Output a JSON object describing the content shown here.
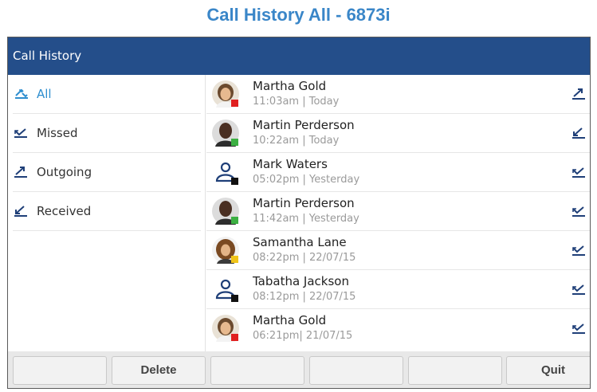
{
  "page": {
    "title": "Call History All - 6873i"
  },
  "screen": {
    "header": "Call History",
    "filters": [
      {
        "label": "All",
        "icon": "all-calls-icon",
        "active": true
      },
      {
        "label": "Missed",
        "icon": "missed-call-icon",
        "active": false
      },
      {
        "label": "Outgoing",
        "icon": "outgoing-call-icon",
        "active": false
      },
      {
        "label": "Received",
        "icon": "received-call-icon",
        "active": false
      }
    ],
    "calls": [
      {
        "name": "Martha Gold",
        "time": "11:03am | Today",
        "avatar": "photo-female-1",
        "status_color": "#e02020",
        "direction": "outgoing-call-icon"
      },
      {
        "name": "Martin Perderson",
        "time": "10:22am | Today",
        "avatar": "photo-male-1",
        "status_color": "#3cb043",
        "direction": "received-call-icon"
      },
      {
        "name": "Mark Waters",
        "time": "05:02pm | Yesterday",
        "avatar": "generic-contact-icon",
        "status_color": "#111111",
        "direction": "missed-call-icon"
      },
      {
        "name": "Martin Perderson",
        "time": "11:42am | Yesterday",
        "avatar": "photo-male-1",
        "status_color": "#3cb043",
        "direction": "missed-call-icon"
      },
      {
        "name": "Samantha Lane",
        "time": "08:22pm | 22/07/15",
        "avatar": "photo-female-2",
        "status_color": "#f0c419",
        "direction": "missed-call-icon"
      },
      {
        "name": "Tabatha Jackson",
        "time": "08:12pm | 22/07/15",
        "avatar": "generic-contact-icon",
        "status_color": "#111111",
        "direction": "missed-call-icon"
      },
      {
        "name": "Martha Gold",
        "time": "06:21pm| 21/07/15",
        "avatar": "photo-female-1",
        "status_color": "#e02020",
        "direction": "missed-call-icon"
      }
    ],
    "softkeys": [
      "",
      "Delete",
      "",
      "",
      "",
      "Quit"
    ]
  },
  "colors": {
    "header_bg": "#244e8a",
    "accent": "#2e8ecf",
    "title": "#3a86c8"
  }
}
